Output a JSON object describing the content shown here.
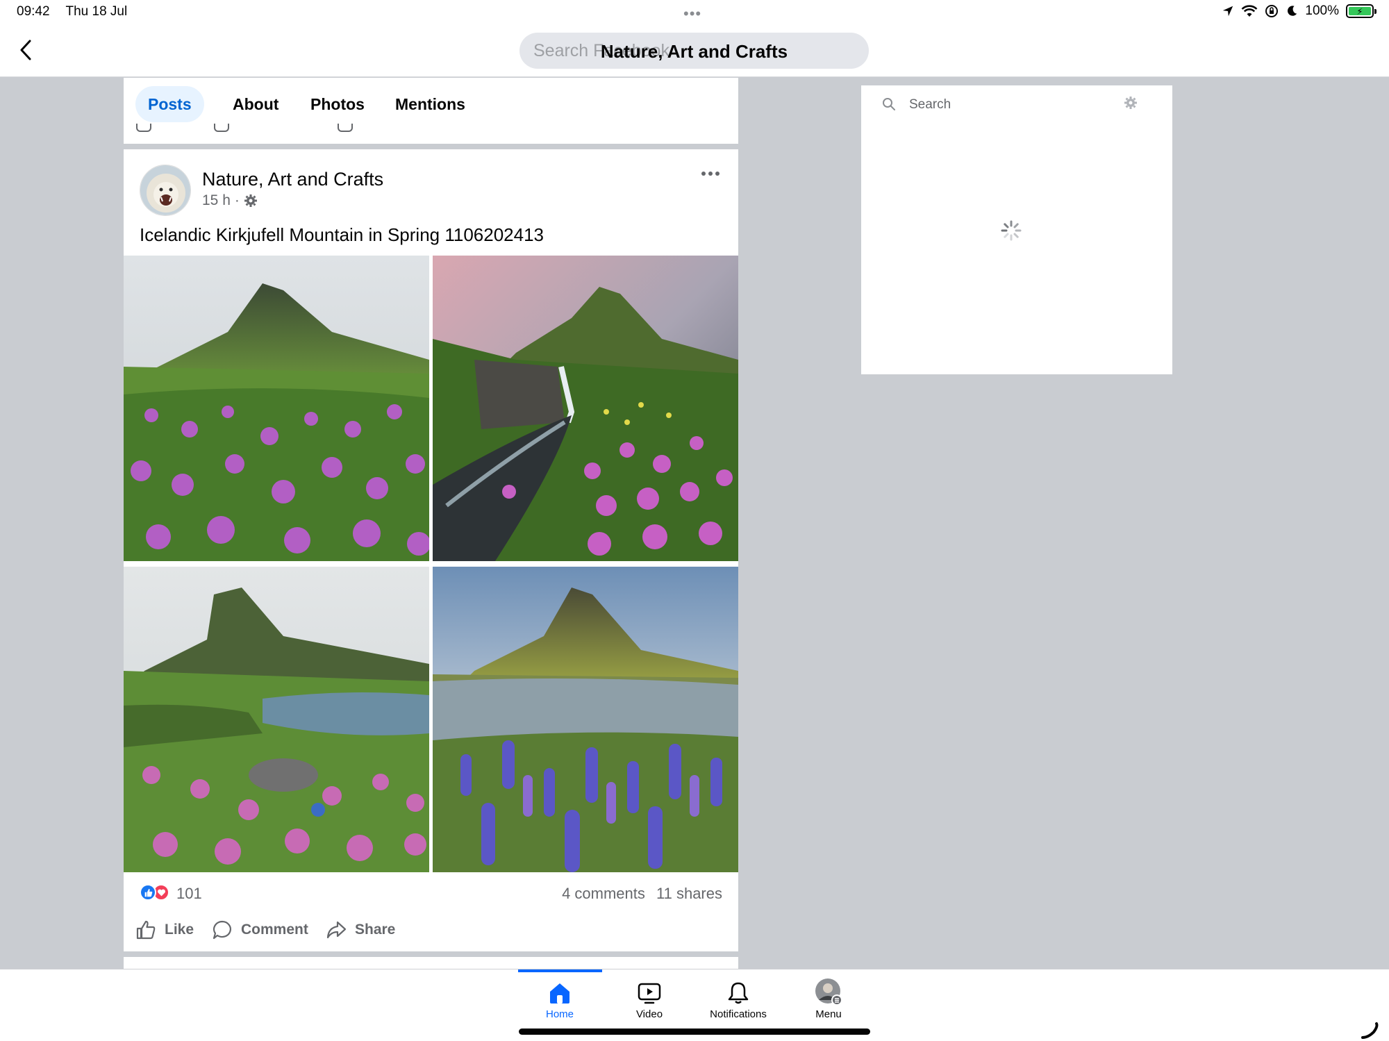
{
  "status_bar": {
    "time": "09:42",
    "date": "Thu 18 Jul",
    "battery": "100%",
    "icons": [
      "location-icon",
      "wifi-icon",
      "screen-lock-icon",
      "moon-icon",
      "battery-charging-icon"
    ]
  },
  "top_nav": {
    "search_placeholder": "Search Facebook",
    "page_title": "Nature, Art and Crafts"
  },
  "tabs": [
    {
      "label": "Posts",
      "active": true
    },
    {
      "label": "About",
      "active": false
    },
    {
      "label": "Photos",
      "active": false
    },
    {
      "label": "Mentions",
      "active": false
    }
  ],
  "post": {
    "page_name": "Nature, Art and Crafts",
    "time": "15 h",
    "privacy_icon": "gear-icon",
    "caption": "Icelandic Kirkjufell Mountain in Spring 1106202413",
    "photos": [
      {
        "name": "photo-1"
      },
      {
        "name": "photo-2"
      },
      {
        "name": "photo-3"
      },
      {
        "name": "photo-4"
      }
    ],
    "reaction_count": "101",
    "comments": "4 comments",
    "shares": "11 shares",
    "actions": {
      "like": "Like",
      "comment": "Comment",
      "share": "Share"
    }
  },
  "right_panel": {
    "search_label": "Search"
  },
  "bottom_nav": {
    "items": [
      {
        "label": "Home",
        "active": true
      },
      {
        "label": "Video",
        "active": false
      },
      {
        "label": "Notifications",
        "active": false
      },
      {
        "label": "Menu",
        "active": false
      }
    ]
  },
  "colors": {
    "accent": "#0866ff",
    "background": "#c9ccd1",
    "like_blue": "#1877f2",
    "love_red": "#f33e58"
  }
}
